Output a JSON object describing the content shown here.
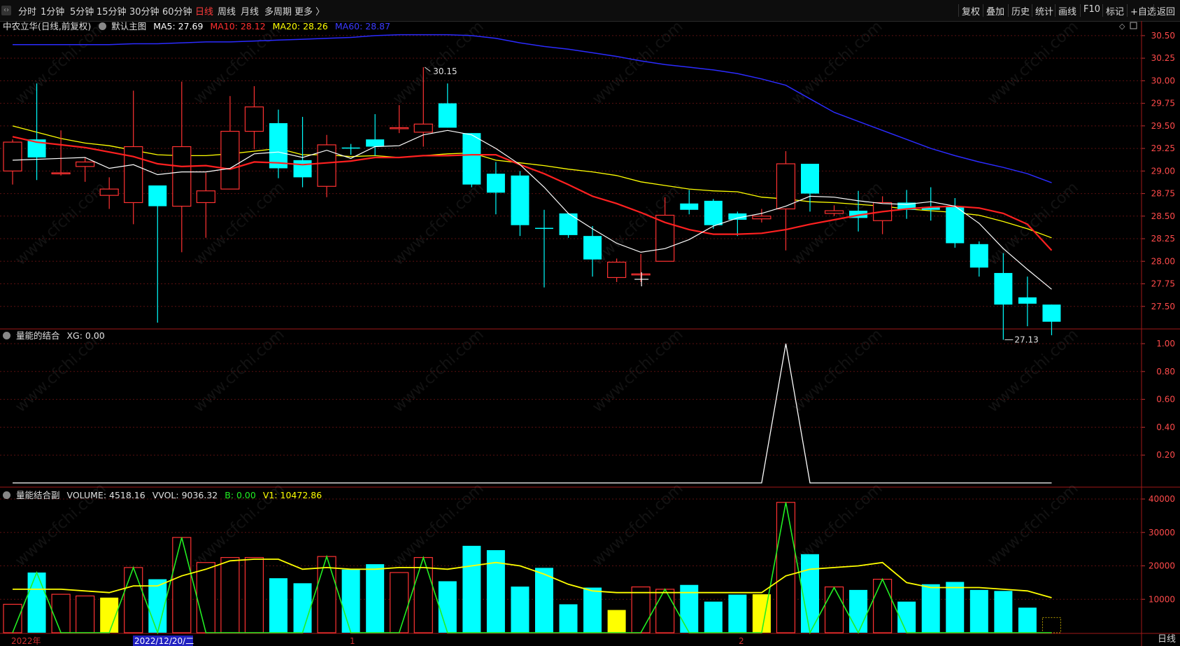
{
  "toolbar": {
    "periods": [
      "分时",
      "1分钟",
      "5分钟",
      "15分钟",
      "30分钟",
      "60分钟",
      "日线",
      "周线",
      "月线",
      "多周期",
      "更多 〉"
    ],
    "active_period": "日线",
    "right_buttons": [
      "复权",
      "叠加",
      "历史",
      "统计",
      "画线",
      "F10",
      "标记",
      "+自选",
      "返回"
    ]
  },
  "main_header": {
    "stock": "中农立华(日线,前复权)",
    "template": "默认主图",
    "ma5": "MA5: 27.69",
    "ma10": "MA10: 28.12",
    "ma20": "MA20: 28.26",
    "ma60": "MA60: 28.87"
  },
  "ind1_header": {
    "name": "量能的结合",
    "value": "XG: 0.00"
  },
  "ind2_header": {
    "name": "量能结合副",
    "volume": "VOLUME: 4518.16",
    "vvol": "VVOL: 9036.32",
    "b": "B: 0.00",
    "v1": "V1: 10472.86"
  },
  "colors": {
    "up": "#ff3232",
    "down": "#00ffff",
    "ma5": "#ffffff",
    "ma10": "#ff2020",
    "ma20": "#ffff00",
    "ma60": "#2b2bff",
    "yellow_bar": "#ffff00",
    "green_line": "#22ee22"
  },
  "bottom_label": "日线",
  "watermark": "www.cfchi.com",
  "chart_data": [
    {
      "type": "candlestick",
      "title": "中农立华(日线,前复权)",
      "ylim": [
        27.25,
        30.6
      ],
      "yticks": [
        27.5,
        27.75,
        28.0,
        28.25,
        28.5,
        28.75,
        29.0,
        29.25,
        29.5,
        29.75,
        30.0,
        30.25,
        30.5
      ],
      "x_labels": [
        "2022年",
        "2022/12/20/二",
        "1",
        "2"
      ],
      "annotations": [
        {
          "text": "30.15",
          "type": "high"
        },
        {
          "text": "27.13",
          "type": "low"
        }
      ],
      "candles": [
        {
          "o": 29.0,
          "c": 29.32,
          "h": 29.35,
          "l": 28.85
        },
        {
          "o": 29.35,
          "c": 29.15,
          "h": 29.97,
          "l": 28.9
        },
        {
          "o": 28.98,
          "c": 28.98,
          "h": 29.45,
          "l": 28.95
        },
        {
          "o": 29.05,
          "c": 29.1,
          "h": 29.15,
          "l": 28.88
        },
        {
          "o": 28.73,
          "c": 28.8,
          "h": 28.93,
          "l": 28.58
        },
        {
          "o": 28.65,
          "c": 29.27,
          "h": 29.89,
          "l": 28.41
        },
        {
          "o": 28.84,
          "c": 28.61,
          "h": 28.84,
          "l": 27.32
        },
        {
          "o": 28.61,
          "c": 29.27,
          "h": 29.99,
          "l": 28.1
        },
        {
          "o": 28.65,
          "c": 28.78,
          "h": 28.98,
          "l": 28.26
        },
        {
          "o": 28.8,
          "c": 29.44,
          "h": 29.83,
          "l": 28.8
        },
        {
          "o": 29.44,
          "c": 29.71,
          "h": 29.94,
          "l": 29.24
        },
        {
          "o": 29.53,
          "c": 29.03,
          "h": 29.68,
          "l": 28.92
        },
        {
          "o": 29.12,
          "c": 28.93,
          "h": 29.6,
          "l": 28.82
        },
        {
          "o": 28.83,
          "c": 29.29,
          "h": 29.4,
          "l": 28.71
        },
        {
          "o": 29.26,
          "c": 29.25,
          "h": 29.3,
          "l": 29.18
        },
        {
          "o": 29.35,
          "c": 29.27,
          "h": 29.63,
          "l": 29.17
        },
        {
          "o": 29.48,
          "c": 29.48,
          "h": 29.73,
          "l": 29.42
        },
        {
          "o": 29.43,
          "c": 29.52,
          "h": 30.15,
          "l": 29.27
        },
        {
          "o": 29.75,
          "c": 29.48,
          "h": 29.97,
          "l": 29.48
        },
        {
          "o": 29.42,
          "c": 28.85,
          "h": 29.42,
          "l": 28.82
        },
        {
          "o": 28.97,
          "c": 28.76,
          "h": 29.1,
          "l": 28.52
        },
        {
          "o": 28.95,
          "c": 28.4,
          "h": 29.0,
          "l": 28.28
        },
        {
          "o": 28.37,
          "c": 28.36,
          "h": 28.57,
          "l": 27.71
        },
        {
          "o": 28.53,
          "c": 28.29,
          "h": 28.53,
          "l": 28.26
        },
        {
          "o": 28.28,
          "c": 28.02,
          "h": 28.39,
          "l": 27.83
        },
        {
          "o": 27.82,
          "c": 27.99,
          "h": 28.03,
          "l": 27.77
        },
        {
          "o": 27.86,
          "c": 27.86,
          "h": 28.08,
          "l": 27.77
        },
        {
          "o": 28.0,
          "c": 28.51,
          "h": 28.71,
          "l": 28.0
        },
        {
          "o": 28.64,
          "c": 28.57,
          "h": 28.79,
          "l": 28.52
        },
        {
          "o": 28.67,
          "c": 28.4,
          "h": 28.69,
          "l": 28.36
        },
        {
          "o": 28.53,
          "c": 28.46,
          "h": 28.55,
          "l": 28.28
        },
        {
          "o": 28.47,
          "c": 28.5,
          "h": 28.58,
          "l": 28.43
        },
        {
          "o": 28.58,
          "c": 29.08,
          "h": 29.22,
          "l": 28.12
        },
        {
          "o": 29.08,
          "c": 28.75,
          "h": 29.08,
          "l": 28.55
        },
        {
          "o": 28.53,
          "c": 28.56,
          "h": 28.62,
          "l": 28.5
        },
        {
          "o": 28.56,
          "c": 28.48,
          "h": 28.78,
          "l": 28.33
        },
        {
          "o": 28.45,
          "c": 28.65,
          "h": 28.72,
          "l": 28.3
        },
        {
          "o": 28.65,
          "c": 28.57,
          "h": 28.79,
          "l": 28.47
        },
        {
          "o": 28.6,
          "c": 28.57,
          "h": 28.82,
          "l": 28.45
        },
        {
          "o": 28.61,
          "c": 28.2,
          "h": 28.7,
          "l": 28.15
        },
        {
          "o": 28.19,
          "c": 27.93,
          "h": 28.22,
          "l": 27.83
        },
        {
          "o": 27.87,
          "c": 27.52,
          "h": 28.09,
          "l": 27.13
        },
        {
          "o": 27.6,
          "c": 27.53,
          "h": 27.83,
          "l": 27.28
        },
        {
          "o": 27.52,
          "c": 27.33,
          "h": 27.52,
          "l": 27.18
        }
      ],
      "ma5": [
        29.12,
        29.13,
        29.14,
        29.15,
        29.03,
        29.07,
        28.96,
        28.99,
        28.99,
        29.03,
        29.19,
        29.21,
        29.15,
        29.23,
        29.14,
        29.27,
        29.28,
        29.4,
        29.45,
        29.4,
        29.25,
        29.07,
        28.82,
        28.53,
        28.36,
        28.2,
        28.1,
        28.14,
        28.24,
        28.39,
        28.48,
        28.53,
        28.61,
        28.72,
        28.71,
        28.67,
        28.64,
        28.63,
        28.66,
        28.61,
        28.42,
        28.14,
        27.91,
        27.69
      ],
      "ma10": [
        29.38,
        29.32,
        29.29,
        29.26,
        29.21,
        29.16,
        29.08,
        29.05,
        29.06,
        29.02,
        29.1,
        29.09,
        29.07,
        29.09,
        29.11,
        29.15,
        29.15,
        29.17,
        29.17,
        29.18,
        29.18,
        29.07,
        28.97,
        28.85,
        28.72,
        28.64,
        28.54,
        28.43,
        28.35,
        28.3,
        28.3,
        28.31,
        28.35,
        28.41,
        28.46,
        28.51,
        28.55,
        28.58,
        28.6,
        28.61,
        28.59,
        28.53,
        28.41,
        28.12
      ],
      "ma20": [
        29.5,
        29.43,
        29.36,
        29.31,
        29.28,
        29.23,
        29.18,
        29.17,
        29.17,
        29.19,
        29.22,
        29.25,
        29.18,
        29.18,
        29.16,
        29.17,
        29.15,
        29.17,
        29.19,
        29.2,
        29.12,
        29.09,
        29.06,
        29.02,
        28.99,
        28.95,
        28.88,
        28.84,
        28.8,
        28.78,
        28.77,
        28.71,
        28.69,
        28.66,
        28.65,
        28.63,
        28.61,
        28.58,
        28.56,
        28.54,
        28.51,
        28.44,
        28.36,
        28.26
      ],
      "ma60": [
        30.4,
        30.4,
        30.4,
        30.4,
        30.4,
        30.41,
        30.41,
        30.42,
        30.43,
        30.43,
        30.44,
        30.45,
        30.46,
        30.47,
        30.48,
        30.5,
        30.51,
        30.51,
        30.51,
        30.5,
        30.47,
        30.42,
        30.38,
        30.35,
        30.31,
        30.27,
        30.22,
        30.18,
        30.15,
        30.12,
        30.08,
        30.02,
        29.95,
        29.8,
        29.65,
        29.55,
        29.45,
        29.35,
        29.25,
        29.17,
        29.1,
        29.04,
        28.97,
        28.87
      ]
    },
    {
      "type": "line",
      "title": "量能的结合",
      "series": [
        {
          "name": "XG",
          "values": [
            0,
            0,
            0,
            0,
            0,
            0,
            0,
            0,
            0,
            0,
            0,
            0,
            0,
            0,
            0,
            0,
            0,
            0,
            0,
            0,
            0,
            0,
            0,
            0,
            0,
            0,
            0,
            0,
            0,
            0,
            0,
            0,
            1,
            0,
            0,
            0,
            0,
            0,
            0,
            0,
            0,
            0,
            0,
            0
          ]
        }
      ],
      "ylim": [
        0,
        1.0
      ],
      "yticks": [
        0.2,
        0.4,
        0.6,
        0.8,
        1.0
      ]
    },
    {
      "type": "bar",
      "title": "量能结合副",
      "ylim": [
        0,
        40000
      ],
      "yticks": [
        10000,
        20000,
        30000,
        40000
      ],
      "volume": [
        8500,
        18000,
        11500,
        11000,
        10500,
        19500,
        16000,
        28500,
        21000,
        22500,
        22500,
        16300,
        14800,
        22800,
        18900,
        20500,
        18000,
        22500,
        15400,
        26000,
        24700,
        13800,
        19400,
        8500,
        13500,
        6800,
        13700,
        13000,
        14300,
        9300,
        11400,
        11500,
        39000,
        23500,
        13700,
        12800,
        16000,
        9300,
        14500,
        15200,
        12800,
        12500,
        7500,
        4518
      ],
      "yellow_marks": [
        4,
        25,
        31
      ],
      "vvol_line": [
        13000,
        13000,
        13000,
        12500,
        12000,
        14000,
        14000,
        17000,
        19000,
        21500,
        22000,
        22000,
        19000,
        19500,
        19000,
        19000,
        19500,
        19500,
        19000,
        20000,
        21000,
        20000,
        17500,
        14500,
        12500,
        12000,
        12000,
        12000,
        12000,
        12000,
        12000,
        12000,
        17000,
        19000,
        19500,
        20000,
        21000,
        15000,
        13500,
        13500,
        13500,
        13000,
        12500,
        10472
      ],
      "green_line": [
        0,
        18000,
        0,
        0,
        0,
        19500,
        0,
        28500,
        0,
        0,
        0,
        0,
        0,
        22800,
        0,
        0,
        0,
        22500,
        0,
        0,
        0,
        0,
        0,
        0,
        0,
        0,
        0,
        13000,
        0,
        0,
        0,
        0,
        39000,
        0,
        13500,
        0,
        16000,
        0,
        0,
        0,
        0,
        0,
        0,
        0
      ]
    }
  ]
}
